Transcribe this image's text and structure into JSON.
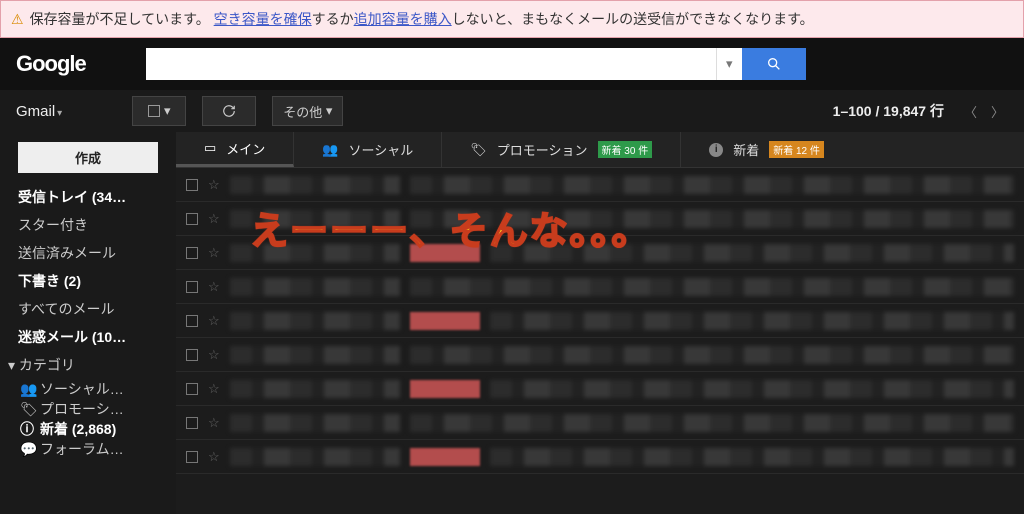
{
  "banner": {
    "text_before": "保存容量が不足しています。",
    "link1": "空き容量を確保",
    "mid1": "するか",
    "link2": "追加容量を購入",
    "text_after": "しないと、まもなくメールの送受信ができなくなります。"
  },
  "logo": "Google",
  "gmail_label": "Gmail",
  "toolbar": {
    "other_label": "その他",
    "counter": "1–100 / 19,847 行"
  },
  "compose_label": "作成",
  "nav": {
    "inbox": "受信トレイ (34…",
    "starred": "スター付き",
    "sent": "送信済みメール",
    "drafts": "下書き (2)",
    "all": "すべてのメール",
    "spam": "迷惑メール (10…",
    "categories_label": "カテゴリ",
    "social": "ソーシャル…",
    "promo": "プロモーシ…",
    "new": "新着 (2,868)",
    "forum": "フォーラム…"
  },
  "tabs": {
    "main": "メイン",
    "social": "ソーシャル",
    "promo": "プロモーション",
    "promo_badge": "新着 30 件",
    "updates": "新着",
    "updates_badge": "新着 12 件"
  },
  "overlay": "えーーー、そんな。。。"
}
